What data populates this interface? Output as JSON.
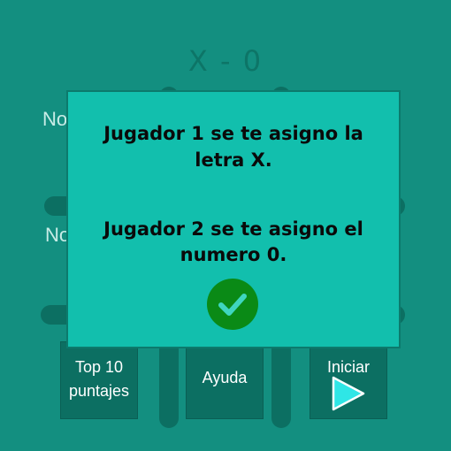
{
  "game": {
    "title": "X - 0",
    "field_labels": [
      "No",
      "No"
    ],
    "menu": {
      "top10_line1": "Top 10",
      "top10_line2": "puntajes",
      "help_label": "Ayuda",
      "start_label": "Iniciar"
    }
  },
  "dialog": {
    "player1_line1": "Jugador 1 se te asigno la",
    "player1_line2": "letra X.",
    "player2_line1": "Jugador 2 se te asigno el",
    "player2_line2": "numero 0.",
    "confirm_icon": "checkmark-icon"
  },
  "colors": {
    "background": "#138f80",
    "dialog": "#12bfad",
    "confirm": "#0a8a16",
    "play_icon": "#2fe6e6"
  }
}
